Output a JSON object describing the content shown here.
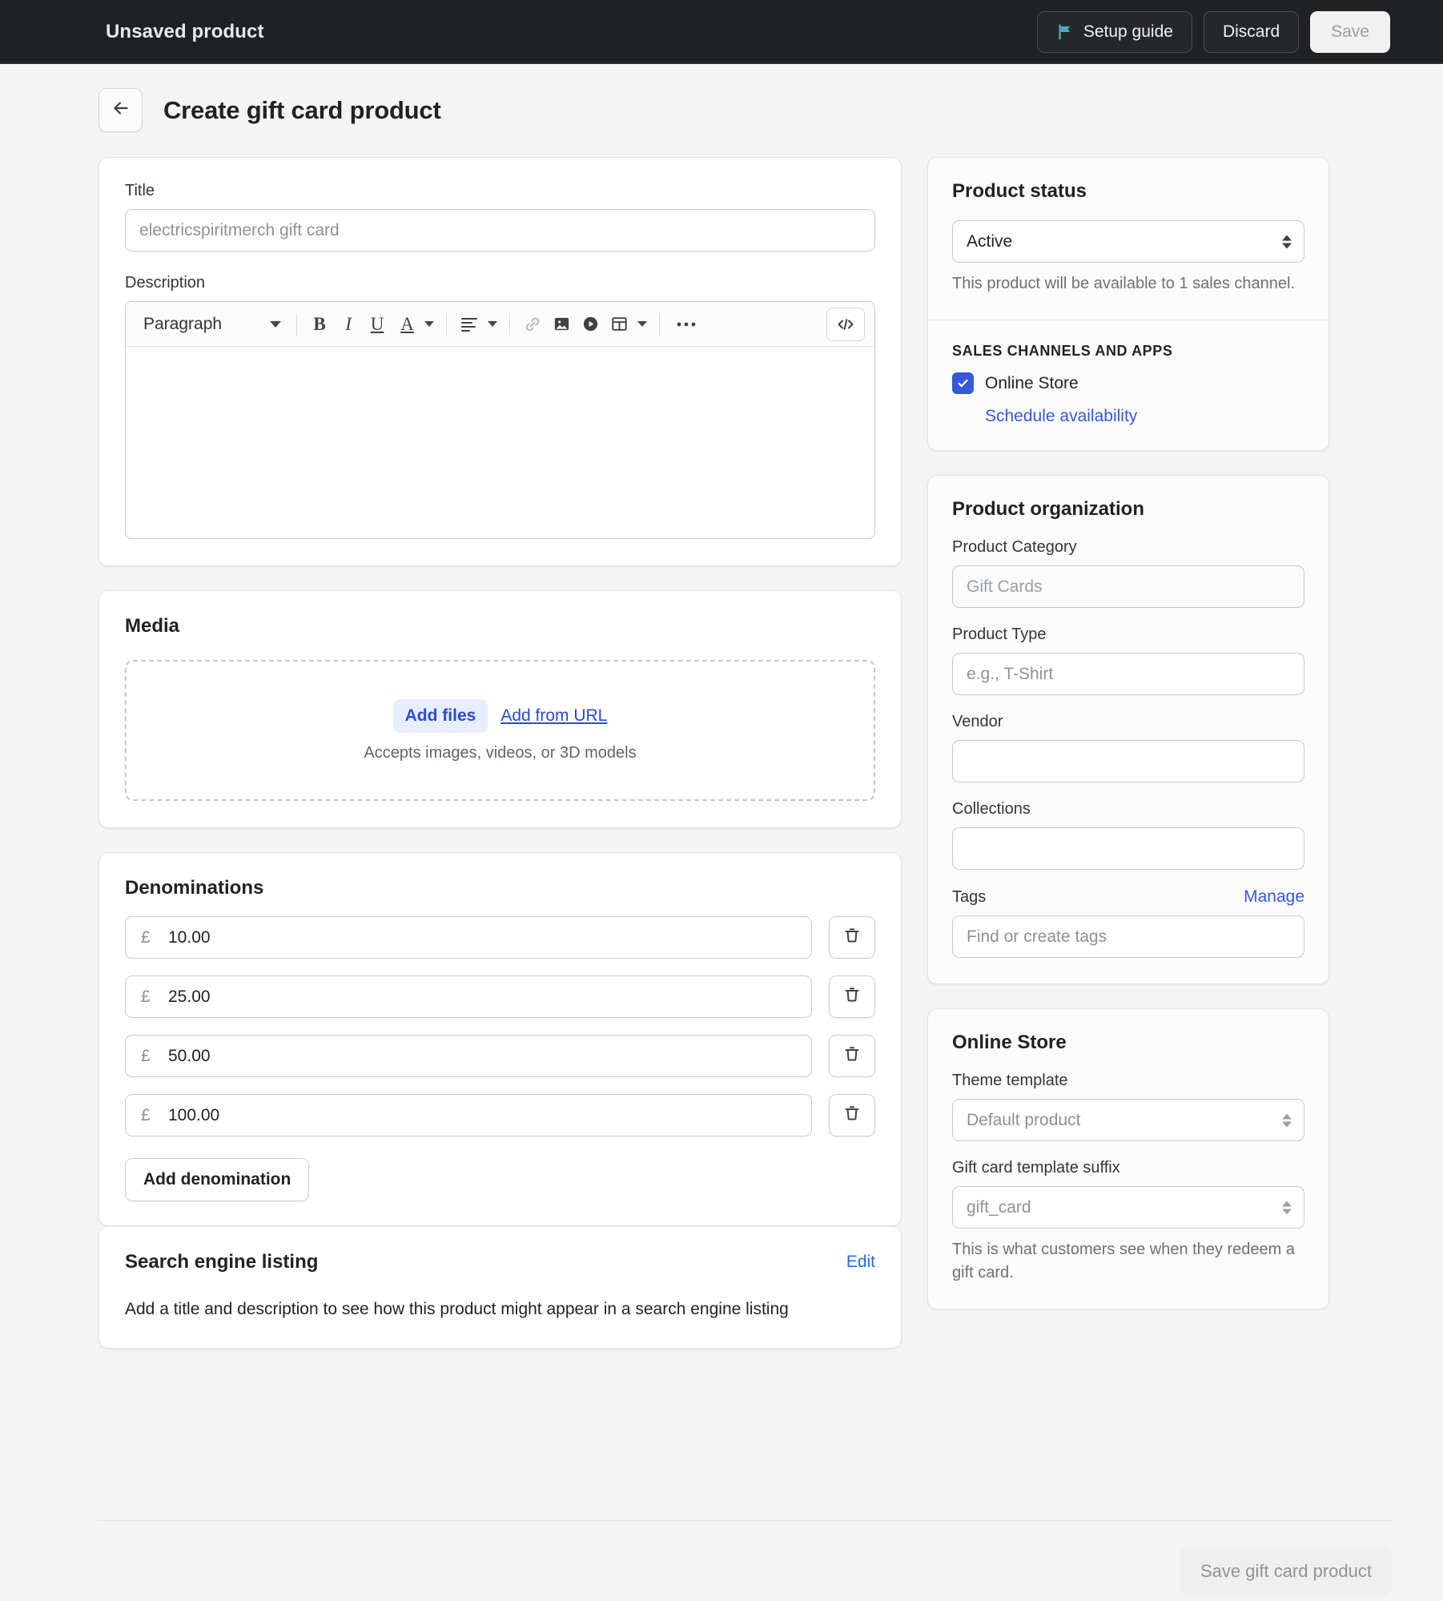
{
  "topbar": {
    "title": "Unsaved product",
    "setup_guide_label": "Setup guide",
    "setup_guide_icon": "flag-icon",
    "discard_label": "Discard",
    "save_label": "Save",
    "flag_color": "#4aa9bb",
    "background": "#1f2124"
  },
  "page": {
    "back_icon": "arrow-left-icon",
    "title": "Create gift card product"
  },
  "title_section": {
    "label": "Title",
    "value": "",
    "placeholder": "electricspiritmerch gift card"
  },
  "description_section": {
    "label": "Description",
    "toolbar": {
      "block_format": "Paragraph",
      "bold": "B",
      "italic": "I",
      "underline": "U",
      "text_color": "A",
      "align_icon": "align-left-icon",
      "link_icon": "link-icon",
      "image_icon": "image-icon",
      "video_icon": "video-play-icon",
      "table_icon": "table-icon",
      "more_icon": "more-horizontal-icon",
      "code_icon": "code-view-icon"
    },
    "value": ""
  },
  "media_section": {
    "title": "Media",
    "add_files_label": "Add files",
    "add_from_url_label": "Add from URL",
    "hint": "Accepts images, videos, or 3D models"
  },
  "denominations_section": {
    "title": "Denominations",
    "currency_symbol": "£",
    "items": [
      {
        "value": "10.00",
        "delete_icon": "trash-icon"
      },
      {
        "value": "25.00",
        "delete_icon": "trash-icon"
      },
      {
        "value": "50.00",
        "delete_icon": "trash-icon"
      },
      {
        "value": "100.00",
        "delete_icon": "trash-icon"
      }
    ],
    "add_label": "Add denomination"
  },
  "seo_section": {
    "title": "Search engine listing",
    "edit_label": "Edit",
    "body": "Add a title and description to see how this product might appear in a search engine listing"
  },
  "product_status": {
    "title": "Product status",
    "status_value": "Active",
    "help": "This product will be available to 1 sales channel.",
    "channels_label": "SALES CHANNELS AND APPS",
    "channel_name": "Online Store",
    "channel_checked": true,
    "schedule_label": "Schedule availability",
    "checkbox_color": "#3559d8"
  },
  "product_organization": {
    "title": "Product organization",
    "category_label": "Product Category",
    "category_placeholder": "Gift Cards",
    "category_value": "",
    "type_label": "Product Type",
    "type_placeholder": "e.g., T-Shirt",
    "type_value": "",
    "vendor_label": "Vendor",
    "vendor_value": "",
    "vendor_placeholder": "",
    "collections_label": "Collections",
    "collections_value": "",
    "collections_placeholder": "",
    "tags_label": "Tags",
    "tags_manage_label": "Manage",
    "tags_placeholder": "Find or create tags",
    "tags_value": ""
  },
  "online_store": {
    "title": "Online Store",
    "theme_template_label": "Theme template",
    "theme_template_value": "Default product",
    "suffix_label": "Gift card template suffix",
    "suffix_value": "gift_card",
    "help": "This is what customers see when they redeem a gift card."
  },
  "footer": {
    "save_label": "Save gift card product"
  }
}
